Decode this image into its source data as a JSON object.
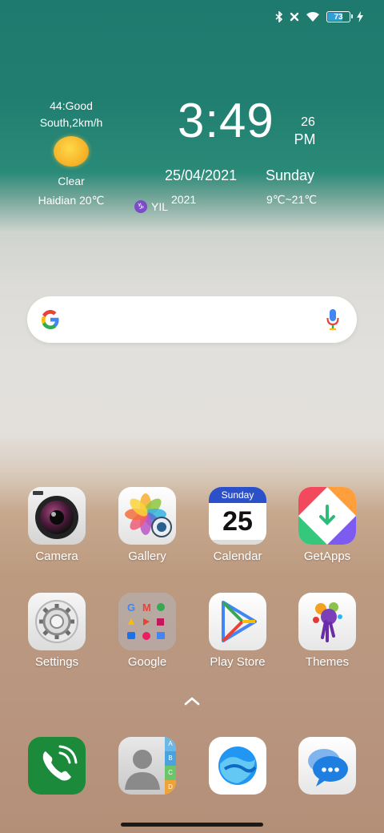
{
  "status_bar": {
    "battery_level": "73",
    "battery_fraction": 0.73,
    "icons": [
      "bluetooth-icon",
      "no-sim-icon",
      "wifi-icon",
      "battery-icon",
      "charging-icon"
    ]
  },
  "weather_widget": {
    "air_quality": "44:Good",
    "wind": "South,2km/h",
    "condition": "Clear",
    "location_temp": "Haidian 20℃",
    "temp_range": "9℃~21℃"
  },
  "clock_widget": {
    "time": "3:49",
    "seconds": "26",
    "ampm": "PM",
    "date": "25/04/2021",
    "weekday": "Sunday",
    "year": "2021",
    "zodiac_text": "YIL",
    "zodiac_symbol": "♑"
  },
  "search": {
    "google_letter": "G"
  },
  "apps": [
    {
      "label": "Camera"
    },
    {
      "label": "Gallery"
    },
    {
      "label": "Calendar",
      "cal_weekday": "Sunday",
      "cal_day": "25"
    },
    {
      "label": "GetApps"
    },
    {
      "label": "Settings"
    },
    {
      "label": "Google"
    },
    {
      "label": "Play Store"
    },
    {
      "label": "Themes"
    }
  ],
  "dock": [
    {
      "name": "phone"
    },
    {
      "name": "contacts",
      "tabs": [
        "A",
        "B",
        "C",
        "D"
      ]
    },
    {
      "name": "browser"
    },
    {
      "name": "messages"
    }
  ],
  "colors": {
    "accent_teal": "#1e7a6e",
    "sand": "#b99680",
    "calendar_blue": "#2c50c8",
    "phone_green": "#1b8a3a"
  }
}
